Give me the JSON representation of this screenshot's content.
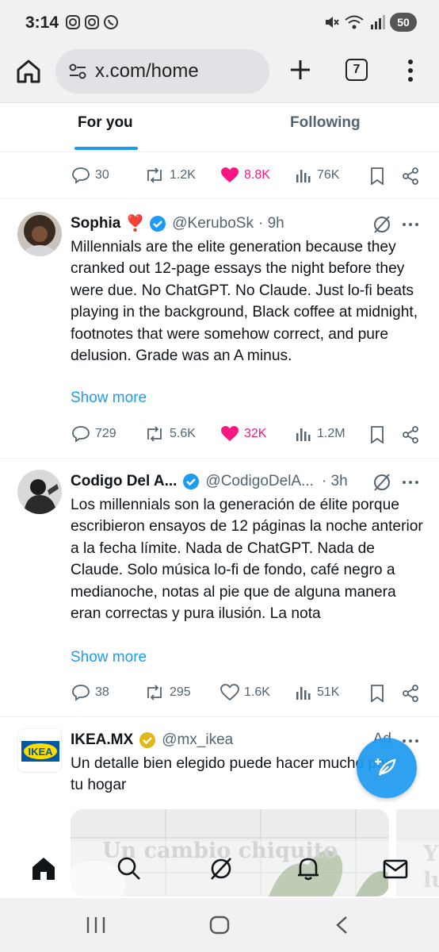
{
  "status_bar": {
    "time": "3:14",
    "left_icons": [
      "instagram-icon",
      "instagram-icon",
      "whatsapp-icon"
    ],
    "right_icons": [
      "mute-icon",
      "wifi-icon",
      "signal-icon"
    ],
    "battery": "50"
  },
  "browser": {
    "url": "x.com/home",
    "tab_count": "7"
  },
  "x_tabs": {
    "for_you": "For you",
    "following": "Following"
  },
  "prev_tweet_actions": {
    "replies": "30",
    "reposts": "1.2K",
    "likes": "8.8K",
    "views": "76K"
  },
  "tweets": [
    {
      "name": "Sophia",
      "name_suffix": "❣️",
      "handle": "@KeruboSk",
      "time": "· 9h",
      "verified": true,
      "text": "Millennials are the elite generation because they cranked out 12-page essays the night before they were due. No ChatGPT. No Claude. Just lo-fi beats playing in the background, Black coffee at midnight, footnotes that were somehow correct, and pure delusion. Grade was an A minus.",
      "show_more": "Show more",
      "replies": "729",
      "reposts": "5.6K",
      "likes": "32K",
      "views": "1.2M"
    },
    {
      "name": "Codigo Del A...",
      "handle": "@CodigoDelA...",
      "time": "· 3h",
      "verified": true,
      "text": "Los millennials son la generación de élite porque escribieron ensayos de 12 páginas la noche anterior a la fecha límite. Nada de ChatGPT. Nada de Claude. Solo música lo-fi de fondo, café negro a medianoche, notas al pie que de alguna manera eran correctas y pura ilusión. La nota",
      "show_more": "Show more",
      "replies": "38",
      "reposts": "295",
      "likes": "1.6K",
      "views": "51K"
    }
  ],
  "ad": {
    "name": "IKEA.MX",
    "handle": "@mx_ikea",
    "label": "Ad",
    "logo_text": "IKEA",
    "text": "Un detalle bien elegido puede hacer mucho por tu hogar",
    "image_text": "Un cambio chiquito",
    "image_text_2": "Y lu"
  },
  "bottom_nav": [
    "home-icon",
    "search-icon",
    "grok-icon",
    "notifications-icon",
    "messages-icon"
  ],
  "colors": {
    "accent": "#1d9bf0",
    "like": "#f91880",
    "muted": "#536471",
    "ikea_blue": "#0058a3",
    "ikea_yellow": "#ffdb00"
  }
}
